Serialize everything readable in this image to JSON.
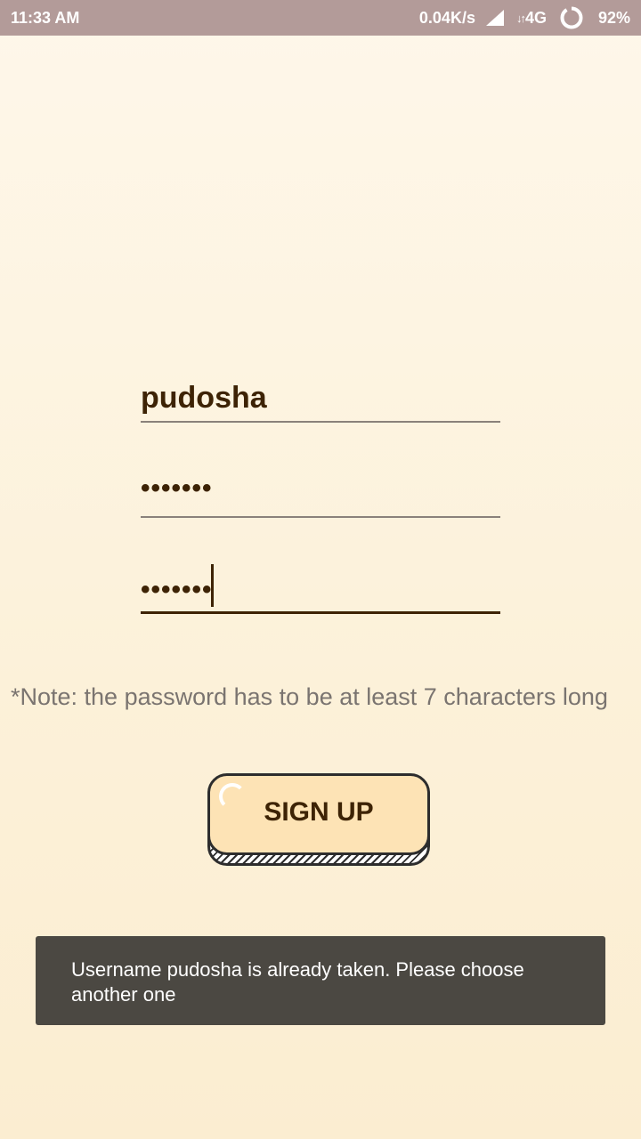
{
  "status_bar": {
    "time": "11:33 AM",
    "network_speed": "0.04K/s",
    "network_type": "4G",
    "network_arrows": "↓↑",
    "battery_percent": "92%",
    "icons": [
      "signal-icon",
      "network-activity-icon",
      "battery-icon"
    ]
  },
  "form": {
    "username_value": "pudosha",
    "password_value": "•••••••",
    "confirm_password_value": "•••••••"
  },
  "note": "*Note: the password has to be at least 7 characters long",
  "signup_button": {
    "label": "SIGN UP"
  },
  "toast": {
    "message": "Username pudosha is already taken. Please choose another one"
  },
  "colors": {
    "status_bar": "#b39b99",
    "background": "#fdf4e2",
    "text_dark": "#3d2305",
    "note_text": "#7a7470",
    "button_face": "#fde3b5",
    "toast_bg": "#4b4842"
  }
}
